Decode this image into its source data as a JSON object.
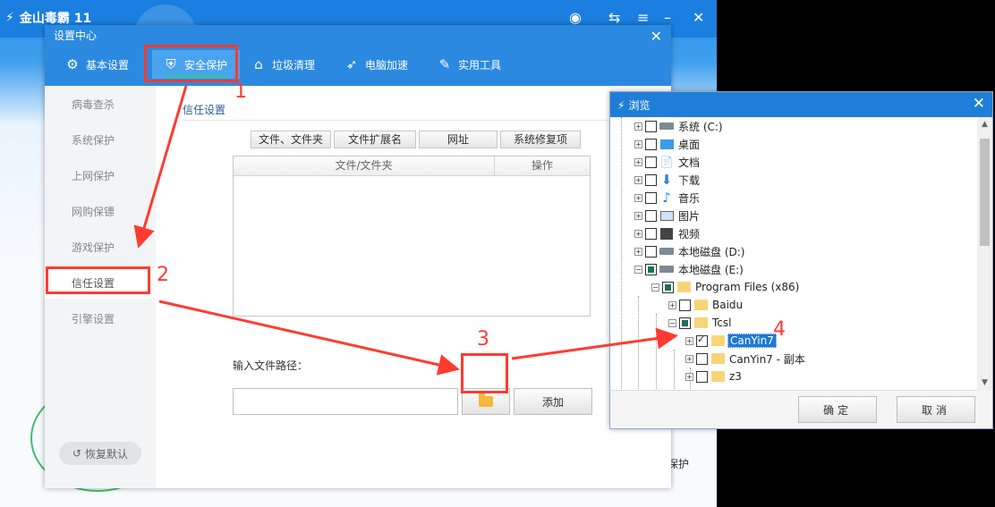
{
  "bg_app": {
    "logo_text": "金山毒霸 11",
    "side_text": "保护"
  },
  "settings": {
    "title": "设置中心",
    "tabs": [
      {
        "label": "基本设置",
        "icon": "gear-icon"
      },
      {
        "label": "安全保护",
        "icon": "shield-icon"
      },
      {
        "label": "垃圾清理",
        "icon": "broom-icon"
      },
      {
        "label": "电脑加速",
        "icon": "rocket-icon"
      },
      {
        "label": "实用工具",
        "icon": "wrench-icon"
      }
    ],
    "sidebar": [
      {
        "label": "病毒查杀"
      },
      {
        "label": "系统保护"
      },
      {
        "label": "上网保护"
      },
      {
        "label": "网购保镖"
      },
      {
        "label": "游戏保护"
      },
      {
        "label": "信任设置"
      },
      {
        "label": "引擎设置"
      }
    ],
    "restore_label": "恢复默认",
    "section_title": "信任设置",
    "subtabs": [
      {
        "label": "文件、文件夹"
      },
      {
        "label": "文件扩展名"
      },
      {
        "label": "网址"
      },
      {
        "label": "系统修复项"
      }
    ],
    "table_headers": {
      "col1": "文件/文件夹",
      "col2": "操作"
    },
    "path_label": "输入文件路径：",
    "path_value": "",
    "add_label": "添加"
  },
  "browse": {
    "title": "浏览",
    "tree": [
      {
        "label": "系统 (C:)",
        "icon": "drive-icon"
      },
      {
        "label": "桌面",
        "icon": "desktop-icon"
      },
      {
        "label": "文档",
        "icon": "document-icon"
      },
      {
        "label": "下载",
        "icon": "download-icon"
      },
      {
        "label": "音乐",
        "icon": "music-icon"
      },
      {
        "label": "图片",
        "icon": "picture-icon"
      },
      {
        "label": "视频",
        "icon": "video-icon"
      },
      {
        "label": "本地磁盘 (D:)",
        "icon": "drive-icon"
      },
      {
        "label": "本地磁盘 (E:)",
        "icon": "drive-icon"
      },
      {
        "label": "Program Files (x86)",
        "icon": "folder-icon"
      },
      {
        "label": "Baidu",
        "icon": "folder-icon"
      },
      {
        "label": "Tcsl",
        "icon": "folder-icon"
      },
      {
        "label": "CanYin7",
        "icon": "folder-icon",
        "checked": true,
        "selected": true
      },
      {
        "label": "CanYin7 - 副本",
        "icon": "folder-icon"
      },
      {
        "label": "z3",
        "icon": "folder-icon"
      }
    ],
    "ok_label": "确定",
    "cancel_label": "取消"
  },
  "annotations": {
    "step1": "1",
    "step2": "2",
    "step3": "3",
    "step4": "4",
    "color": "#ff3b30"
  }
}
